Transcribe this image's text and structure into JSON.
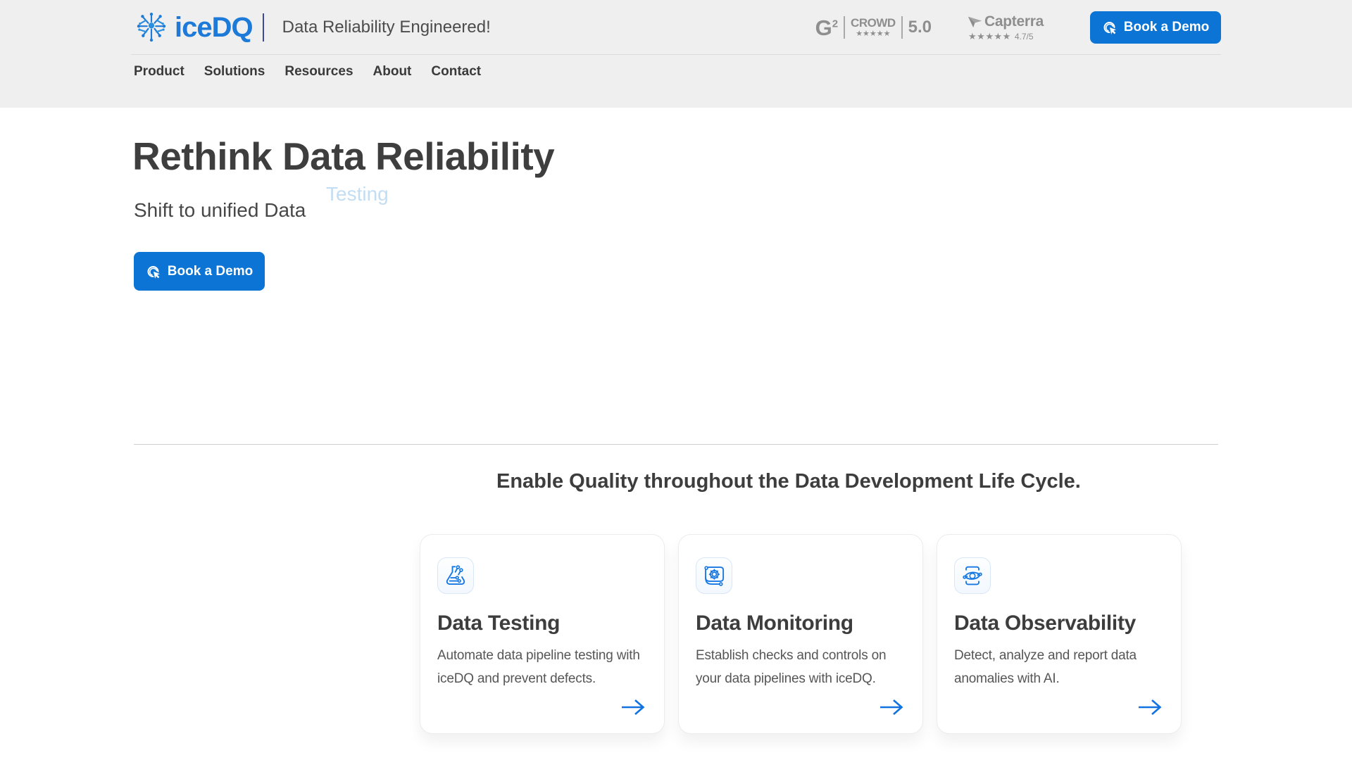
{
  "header": {
    "brand": "iceDQ",
    "tagline": "Data Reliability Engineered!",
    "ratings": {
      "g2": {
        "letter": "G",
        "sup": "2",
        "word": "CROWD",
        "stars": "★★★★★",
        "score": "5.0"
      },
      "capterra": {
        "name": "Capterra",
        "stars": "★★★★★",
        "score": "4.7/5"
      }
    },
    "demo_button_label": "Book a Demo",
    "nav": [
      {
        "label": "Product"
      },
      {
        "label": "Solutions"
      },
      {
        "label": "Resources"
      },
      {
        "label": "About"
      },
      {
        "label": "Contact"
      }
    ]
  },
  "hero": {
    "title": "Rethink Data Reliability",
    "subtitle_prefix": "Shift to unified Data",
    "rotating_word": "Testing",
    "cta_label": "Book a Demo"
  },
  "section": {
    "heading": "Enable Quality throughout the Data Development Life Cycle.",
    "cards": [
      {
        "icon": "flask-circuit-icon",
        "title": "Data Testing",
        "description": "Automate data pipeline testing with iceDQ and prevent defects."
      },
      {
        "icon": "gear-circuit-icon",
        "title": "Data Monitoring",
        "description": "Establish checks and controls on your data pipelines with iceDQ."
      },
      {
        "icon": "observability-eye-icon",
        "title": "Data Observability",
        "description": "Detect, analyze and report data anomalies with AI."
      }
    ]
  },
  "colors": {
    "brand_blue": "#0c74d4",
    "logo_blue": "#1d7ad8",
    "icon_blue": "#1778e2",
    "header_bg": "#efefef",
    "heading_text": "#3e3e3e",
    "body_text": "#565656",
    "rating_gray": "#8e8e8e",
    "rotating_word_blue": "#c3ddf3"
  }
}
